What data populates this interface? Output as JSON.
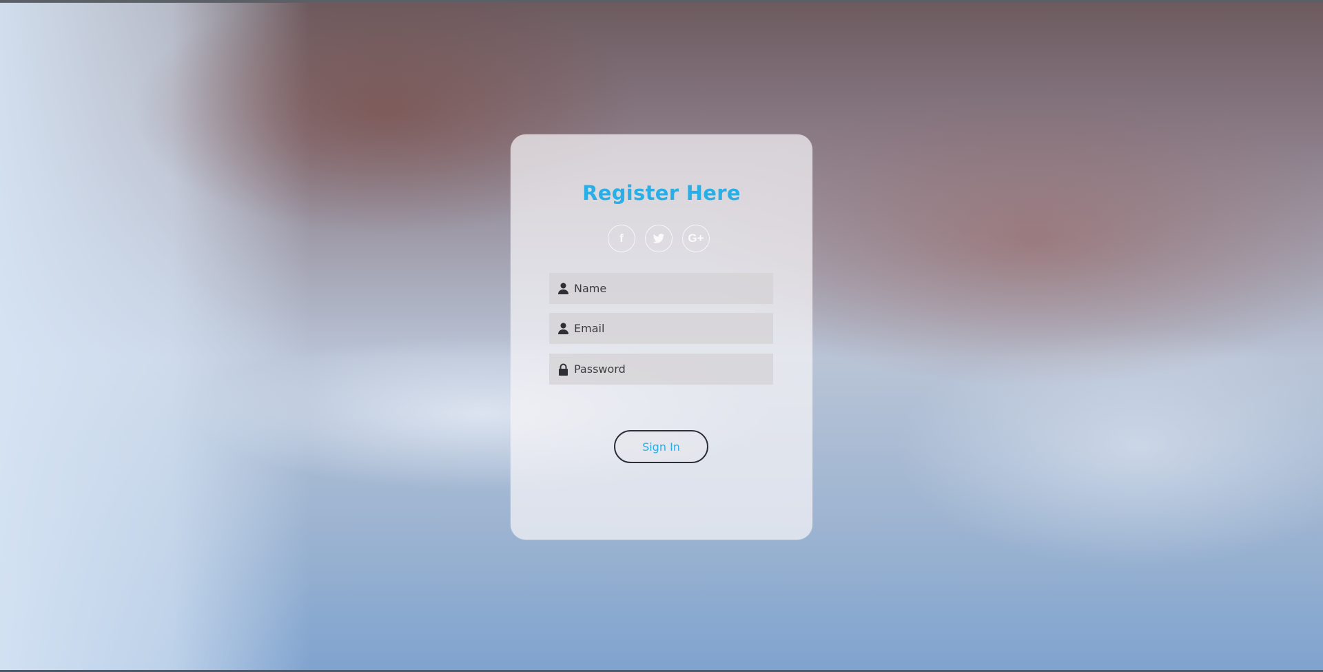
{
  "background": {
    "description_icon": "hands-typing-photo"
  },
  "form": {
    "title": "Register Here",
    "socials": [
      {
        "icon": "facebook-icon",
        "glyph": "f"
      },
      {
        "icon": "twitter-icon",
        "glyph": ""
      },
      {
        "icon": "google-plus-icon",
        "glyph": "G+"
      }
    ],
    "fields": {
      "name": {
        "placeholder": "Name",
        "icon": "user-icon"
      },
      "email": {
        "placeholder": "Email",
        "icon": "user-icon"
      },
      "password": {
        "placeholder": "Password",
        "icon": "lock-icon"
      }
    },
    "submit_label": "Sign In"
  },
  "colors": {
    "accent": "#29aee6",
    "button_border": "#2c2f38",
    "field_bg": "#d4d2d4"
  }
}
